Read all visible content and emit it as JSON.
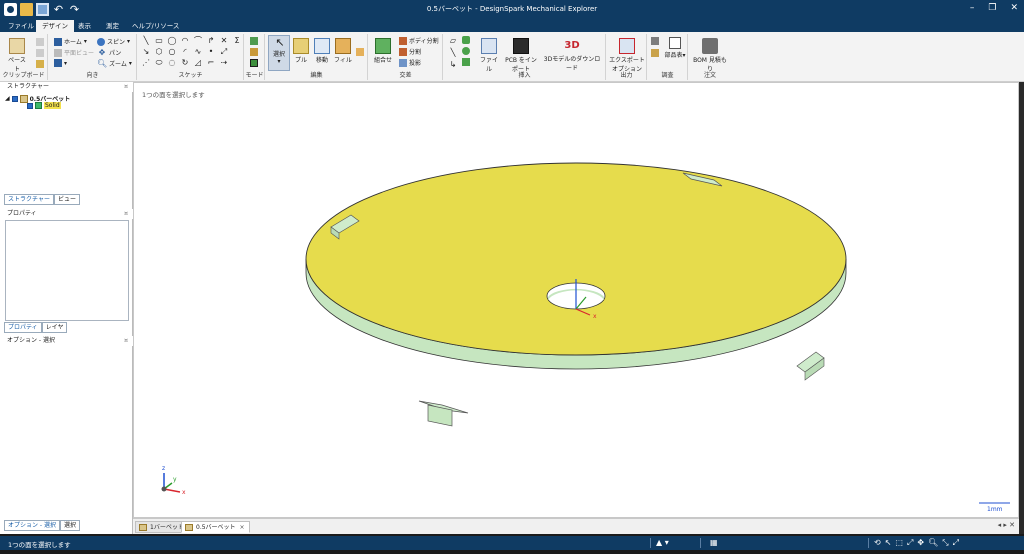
{
  "window": {
    "title": "0.5バーベット - DesignSpark  Mechanical  Explorer",
    "quick_access": [
      "app-logo",
      "open-folder-icon",
      "save-icon",
      "undo-icon",
      "redo-icon"
    ],
    "controls": [
      "minimize",
      "restore",
      "close"
    ]
  },
  "ribbon_tabs": [
    {
      "label": "ファイル",
      "active": false
    },
    {
      "label": "デザイン",
      "active": true
    },
    {
      "label": "表示",
      "active": false
    },
    {
      "label": "測定",
      "active": false
    },
    {
      "label": "ヘルプ/リソース",
      "active": false
    }
  ],
  "ribbon": {
    "clipboard": {
      "label": "クリップボード",
      "paste": "ペースト"
    },
    "orient": {
      "label": "向き",
      "home": "ホーム",
      "plane_view": "平面ビュー",
      "spin": "スピン",
      "pan": "パン",
      "zoom": "ズーム"
    },
    "sketch": {
      "label": "スケッチ",
      "sigma": "Σ"
    },
    "mode": {
      "label": "モード"
    },
    "edit": {
      "label": "編集",
      "select": "選択",
      "pull": "プル",
      "move": "移動",
      "fill": "フィル"
    },
    "intersect": {
      "label": "交差",
      "combine": "組合せ",
      "split_body": "ボディ分割",
      "split": "分割",
      "project": "投影"
    },
    "insert": {
      "label": "挿入",
      "file": "ファイル",
      "pcb_import": "PCB をインポート",
      "download_3d": "3Dモデルのダウンロード",
      "badge_3d": "3D"
    },
    "output": {
      "label": "出力",
      "export_options": "エクスポートオプション"
    },
    "investigate": {
      "label": "調査",
      "bom_table": "部品表"
    },
    "order": {
      "label": "注文",
      "bom_quote": "BOM 見積もり"
    }
  },
  "structure_panel": {
    "header": "ストラクチャー",
    "root": "0.5バーベット",
    "child": "Solid",
    "tabs": [
      "ストラクチャー",
      "ビュー"
    ]
  },
  "properties_panel": {
    "header": "プロパティ",
    "tabs": [
      "プロパティ",
      "レイヤ"
    ]
  },
  "options_panel": {
    "header": "オプション - 選択"
  },
  "bottom_left_tabs": [
    "オプション - 選択",
    "選択"
  ],
  "viewport": {
    "hint": "1つの面を選択します",
    "scale_label": "1mm",
    "triad": {
      "x": "x",
      "y": "y",
      "z": "z"
    },
    "colors": {
      "face": "#e6dc4c",
      "side": "#c6e6c0",
      "tab": "#cfeccc",
      "outline": "#333333"
    }
  },
  "doc_tabs": [
    {
      "label": "1バーベット",
      "active": false
    },
    {
      "label": "0.5バーベット",
      "active": true,
      "close": "×"
    }
  ],
  "status_bar": {
    "message": "1つの面を選択します"
  }
}
